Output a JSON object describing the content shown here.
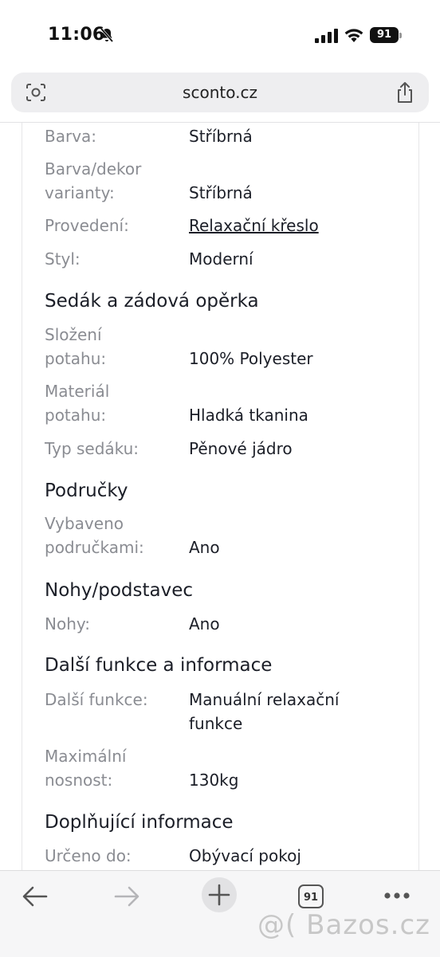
{
  "status": {
    "time": "11:06",
    "battery": "91"
  },
  "browser": {
    "url": "sconto.cz",
    "tabs_count": "91"
  },
  "rows_top": [
    {
      "label": "Barva:",
      "value": "Stříbrná"
    },
    {
      "label_line1": "Barva/dekor",
      "label_line2": "varianty:",
      "value": "Stříbrná"
    },
    {
      "label": "Provedení:",
      "value": "Relaxační křeslo"
    },
    {
      "label": "Styl:",
      "value": "Moderní"
    }
  ],
  "sections": {
    "seat": {
      "title": "Sedák a zádová opěrka",
      "rows": [
        {
          "label_line1": "Složení",
          "label_line2": "potahu:",
          "value": "100% Polyester"
        },
        {
          "label_line1": "Materiál",
          "label_line2": "potahu:",
          "value": "Hladká tkanina"
        },
        {
          "label": "Typ sedáku:",
          "value": "Pěnové jádro"
        }
      ]
    },
    "armrests": {
      "title": "Područky",
      "rows": [
        {
          "label_line1": "Vybaveno",
          "label_line2": "područkami:",
          "value": "Ano"
        }
      ]
    },
    "legs": {
      "title": "Nohy/podstavec",
      "rows": [
        {
          "label": "Nohy:",
          "value": "Ano"
        }
      ]
    },
    "more": {
      "title": "Další funkce a informace",
      "rows": [
        {
          "label": "Další funkce:",
          "value_line1": "Manuální relaxační",
          "value_line2": "funkce"
        },
        {
          "label_line1": "Maximální",
          "label_line2": "nosnost:",
          "value": "130kg"
        }
      ]
    },
    "extra": {
      "title": "Doplňující informace",
      "rows": [
        {
          "label": "Určeno do:",
          "value": "Obývací pokoj"
        }
      ]
    }
  },
  "watermark": "@( Bazos.cz",
  "colors": {
    "label": "#8a8c92",
    "value": "#1b1e27",
    "toolbar_bg": "#f6f6f7",
    "addr_bg": "#eeeef0"
  },
  "icons": {
    "status": [
      "bell-slash-icon",
      "signal-icon",
      "wifi-icon",
      "battery-icon"
    ],
    "addr": [
      "camera-search-icon",
      "share-icon"
    ],
    "toolbar": [
      "back-arrow-icon",
      "forward-arrow-icon",
      "new-tab-plus-icon",
      "tabs-icon",
      "more-dots-icon"
    ]
  }
}
